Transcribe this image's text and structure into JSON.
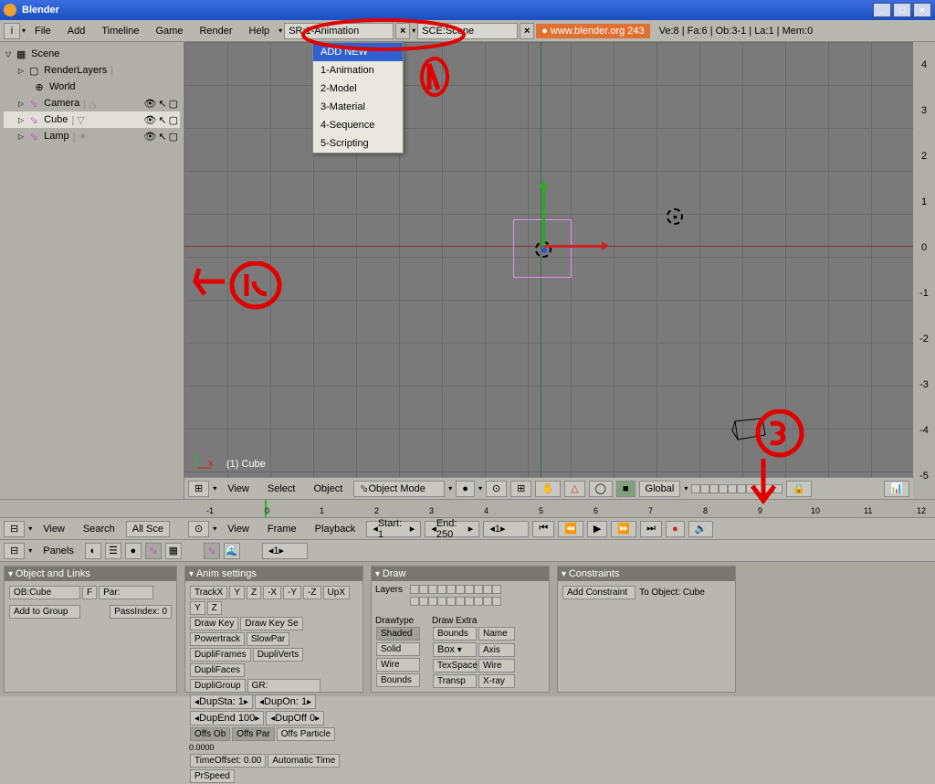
{
  "window": {
    "title": "Blender"
  },
  "topmenu": {
    "items": [
      "File",
      "Add",
      "Timeline",
      "Game",
      "Render",
      "Help"
    ],
    "screen": "SR:1-Animation",
    "scene": "SCE:Scene",
    "link": "www.blender.org 243",
    "stats": "Ve:8 | Fa:6 | Ob:3-1 | La:1 | Mem:0"
  },
  "dropdown": {
    "header": "ADD NEW",
    "items": [
      "1-Animation",
      "2-Model",
      "3-Material",
      "4-Sequence",
      "5-Scripting"
    ]
  },
  "outliner": {
    "root": "Scene",
    "items": [
      "RenderLayers",
      "World",
      "Camera",
      "Cube",
      "Lamp"
    ]
  },
  "viewport": {
    "object_label": "(1) Cube",
    "bar_items": [
      "View",
      "Select",
      "Object"
    ],
    "mode": "Object Mode",
    "orient": "Global"
  },
  "ruler": {
    "vals": [
      "4",
      "3",
      "2",
      "1",
      "0",
      "-1",
      "-2",
      "-3",
      "-4",
      "-5"
    ]
  },
  "timeline": {
    "marks": [
      "-1",
      "0",
      "1",
      "2",
      "3",
      "4",
      "5",
      "6",
      "7",
      "8",
      "9",
      "10",
      "11",
      "12"
    ],
    "bar_items": [
      "View",
      "Frame",
      "Playback"
    ],
    "start": "Start: 1",
    "end": "End: 250",
    "current": "1"
  },
  "outliner_bar": {
    "items": [
      "View",
      "Search"
    ],
    "filter": "All Sce"
  },
  "panels_bar": {
    "label": "Panels",
    "num": "1"
  },
  "panel_obj": {
    "title": "Object and Links",
    "ob": "OB:Cube",
    "f": "F",
    "par": "Par:",
    "add_group": "Add to Group",
    "passindex": "PassIndex: 0"
  },
  "panel_anim": {
    "title": "Anim settings",
    "trackx": "TrackX",
    "upx": "UpX",
    "row1": [
      "Draw Key",
      "Draw Key Se",
      "Powertrack",
      "SlowPar"
    ],
    "row2": [
      "DupliFrames",
      "DupliVerts",
      "DupliFaces"
    ],
    "row3": [
      "DupliGroup",
      "GR:"
    ],
    "dupsta": "DupSta: 1",
    "dupon": "DupOn: 1",
    "dupend": "DupEnd 100",
    "dupoff": "DupOff 0",
    "row4": [
      "Offs Ob",
      "Offs Par",
      "Offs Particle"
    ],
    "offset_val": "0.0000",
    "row5": [
      "TimeOffset: 0.00",
      "Automatic Time",
      "PrSpeed"
    ]
  },
  "panel_draw": {
    "title": "Draw",
    "layers": "Layers",
    "drawtype": "Drawtype",
    "drawtype_opts": [
      "Shaded",
      "Solid",
      "Wire",
      "Bounds"
    ],
    "drawextra": "Draw Extra",
    "extra_col1": [
      "Bounds",
      "Box",
      "TexSpace",
      "Transp"
    ],
    "extra_col2": [
      "Name",
      "Axis",
      "Wire",
      "X-ray"
    ]
  },
  "panel_constraints": {
    "title": "Constraints",
    "add": "Add Constraint",
    "to_obj": "To Object: Cube"
  }
}
